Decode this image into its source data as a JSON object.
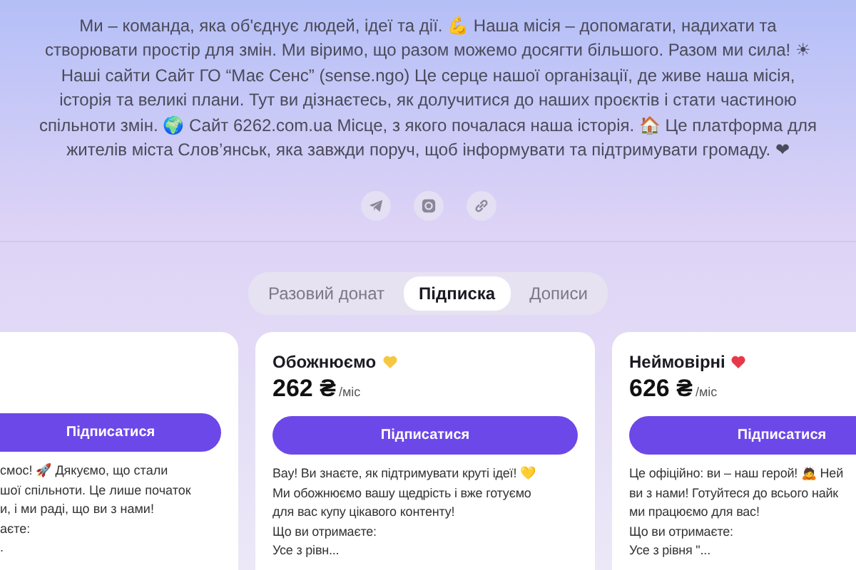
{
  "about": {
    "text": "Ми – команда, яка об'єднує людей, ідеї та дії. 💪 Наша місія – допомагати, надихати та\nстворювати простір для змін. Ми віримо, що разом можемо досягти більшого. Разом ми сила! ☀\nНаші сайти Сайт ГО “Має Сенс” (sense.ngo) Це серце нашої організації, де живе наша місія,\nісторія та великі плани. Тут ви дізнаєтесь, як долучитися до наших проєктів і стати частиною\nспільноти змін. 🌍 Сайт 6262.com.ua Місце, з якого почалася наша історія. 🏠 Це платформа для\nжителів міста Слов’янськ, яка завжди поруч, щоб інформувати та підтримувати громаду. ❤"
  },
  "social_links": [
    {
      "kind": "telegram"
    },
    {
      "kind": "instagram"
    },
    {
      "kind": "link"
    }
  ],
  "tabs": [
    {
      "label": "Разовий донат",
      "selected": false
    },
    {
      "label": "Підписка",
      "selected": true
    },
    {
      "label": "Дописи",
      "selected": false
    }
  ],
  "tiers": [
    {
      "kind": "partial",
      "button": "Підписатися",
      "description": "смос! 🚀 Дякуємо, що стали\nшої спільноти. Це лише початок\nи, і ми раді, що ви з нами!\nаєте:\n."
    },
    {
      "kind": "full",
      "title": "Обожнюємо",
      "color": "#f5c842",
      "price": "262 ₴",
      "period": "/міс",
      "button": "Підписатися",
      "description": "Вау! Ви знаєте, як підтримувати круті ідеї! 💛\nМи обожнюємо вашу щедрість і вже готуємо\nдля вас купу цікавого контенту!\nЩо ви отримаєте:\nУсе з рівн..."
    },
    {
      "kind": "full",
      "title": "Неймовірні",
      "color": "#e8394a",
      "price": "626 ₴",
      "period": "/міс",
      "button": "Підписатися",
      "description": "Це офіційно: ви – наш герой! 🙇 Ней\nви з нами! Готуйтеся до всього найк\nми працюємо для вас!\nЩо ви отримаєте:\nУсе з рівня \"..."
    }
  ]
}
